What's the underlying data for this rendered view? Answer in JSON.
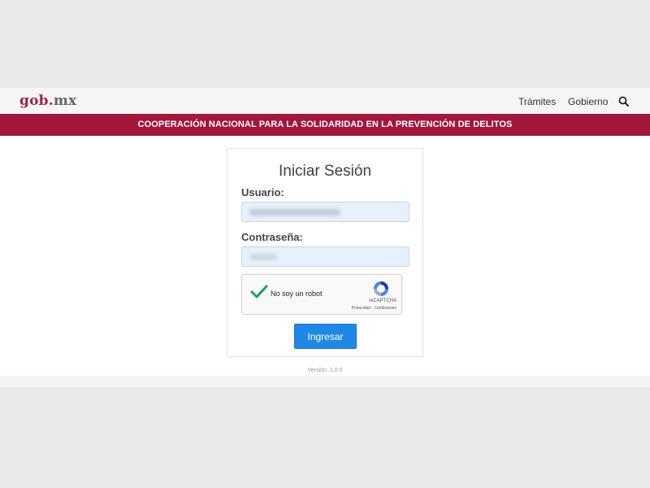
{
  "header": {
    "logo_main": "gob",
    "logo_dot": ".",
    "logo_suffix": "mx",
    "nav": [
      "Trámites",
      "Gobierno"
    ],
    "search_icon": "search-icon"
  },
  "banner": {
    "text": "COOPERACIÓN NACIONAL PARA LA SOLIDARIDAD EN LA PREVENCIÓN DE DELITOS"
  },
  "login": {
    "title": "Iniciar Sesión",
    "user_label": "Usuario:",
    "password_label": "Contraseña:",
    "submit_label": "Ingresar"
  },
  "captcha": {
    "label": "No soy un robot",
    "brand": "reCAPTCHA",
    "links": "Privacidad - Condiciones",
    "checked": true
  },
  "footer": {
    "version": "Versión: 1.0.0"
  },
  "colors": {
    "brand": "#9d2449",
    "banner": "#a3173c",
    "button": "#1e88e5",
    "input_bg": "#e8f0fe"
  }
}
